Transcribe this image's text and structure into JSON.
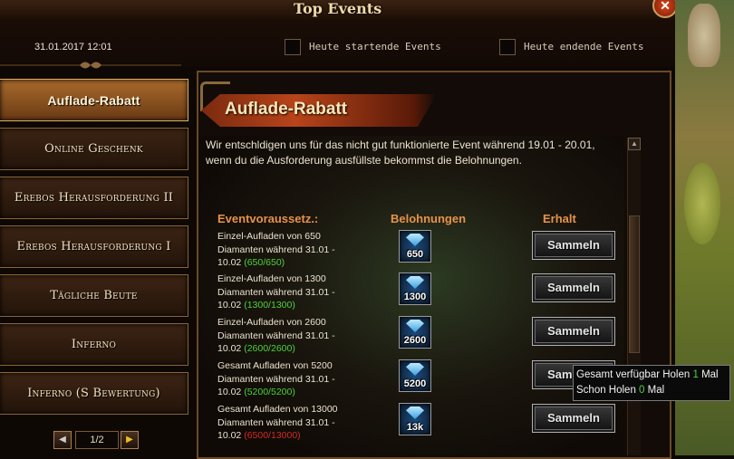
{
  "window": {
    "title": "Top Events",
    "close_label": "✕"
  },
  "topbar": {
    "datetime": "31.01.2017 12:01",
    "filter_today_start": "Heute startende Events",
    "filter_today_end": "Heute endende Events"
  },
  "sidebar": {
    "items": [
      {
        "label": "Auflade-Rabatt",
        "active": true
      },
      {
        "label": "Online Geschenk",
        "active": false
      },
      {
        "label": "Erebos Herausforderung II",
        "active": false
      },
      {
        "label": "Erebos Herausforderung I",
        "active": false
      },
      {
        "label": "Tägliche Beute",
        "active": false
      },
      {
        "label": "Inferno",
        "active": false
      },
      {
        "label": "Inferno (S Bewertung)",
        "active": false
      }
    ],
    "pager": {
      "prev": "◀",
      "page": "1/2",
      "next": "▶"
    }
  },
  "event": {
    "title": "Auflade-Rabatt",
    "description": "Wir entschldigen uns für das nicht gut funktionierte Event während 19.01 - 20.01, wenn du die Ausforderung ausfüllste bekommst die Belohnungen.",
    "headers": {
      "condition": "Eventvoraussetz.:",
      "rewards": "Belohnungen",
      "received": "Erhalt"
    },
    "rows": [
      {
        "line1": "Einzel-Aufladen von 650",
        "line2": "Diamanten während 31.01 -",
        "line3": "10.02",
        "progress": "(650/650)",
        "progress_complete": true,
        "reward_amount": "650",
        "button": "Sammeln"
      },
      {
        "line1": "Einzel-Aufladen von 1300",
        "line2": "Diamanten während 31.01 -",
        "line3": "10.02",
        "progress": "(1300/1300)",
        "progress_complete": true,
        "reward_amount": "1300",
        "button": "Sammeln"
      },
      {
        "line1": "Einzel-Aufladen von 2600",
        "line2": "Diamanten während 31.01 -",
        "line3": "10.02",
        "progress": "(2600/2600)",
        "progress_complete": true,
        "reward_amount": "2600",
        "button": "Sammeln"
      },
      {
        "line1": "Gesamt Aufladen von 5200",
        "line2": "Diamanten während 31.01 -",
        "line3": "10.02",
        "progress": "(5200/5200)",
        "progress_complete": true,
        "reward_amount": "5200",
        "button": "Sammeln"
      },
      {
        "line1": "Gesamt Aufladen von 13000",
        "line2": "Diamanten während 31.01 -",
        "line3": "10.02",
        "progress": "(6500/13000)",
        "progress_complete": false,
        "reward_amount": "13k",
        "button": "Sammeln"
      }
    ]
  },
  "tooltip": {
    "line1_prefix": "Gesamt verfügbar  Holen ",
    "line1_value": "1",
    "line1_suffix": " Mal",
    "line2_prefix": "Schon Holen ",
    "line2_value": "0",
    "line2_suffix": " Mal"
  },
  "colors": {
    "accent_orange": "#e7924a",
    "progress_green": "#4cd23c",
    "progress_red": "#d52a20",
    "active_tab": "#a86a2c"
  }
}
